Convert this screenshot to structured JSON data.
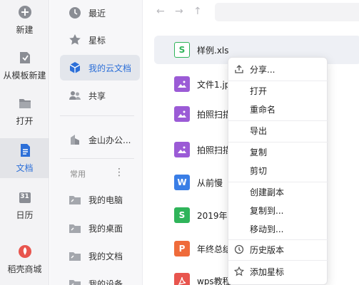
{
  "rail": {
    "items": [
      {
        "label": "新建",
        "icon": "plus-circle-icon"
      },
      {
        "label": "从模板新建",
        "icon": "template-icon"
      },
      {
        "label": "打开",
        "icon": "folder-open-icon"
      },
      {
        "label": "文档",
        "icon": "document-icon"
      },
      {
        "label": "日历",
        "icon": "calendar-icon"
      },
      {
        "label": "稻壳商城",
        "icon": "docer-store-icon"
      }
    ],
    "calendar_day": "31",
    "active_index": 3
  },
  "nav": {
    "items": [
      {
        "label": "最近",
        "icon": "clock-icon"
      },
      {
        "label": "星标",
        "icon": "star-icon"
      },
      {
        "label": "我的云文档",
        "icon": "cloud-cube-icon"
      },
      {
        "label": "共享",
        "icon": "people-icon"
      },
      {
        "label": "金山办公...",
        "icon": "building-icon"
      }
    ],
    "section_label": "常用",
    "section_more": "⋮",
    "shortcuts": [
      {
        "label": "我的电脑",
        "icon": "computer-folder-icon"
      },
      {
        "label": "我的桌面",
        "icon": "desktop-folder-icon"
      },
      {
        "label": "我的文档",
        "icon": "documents-folder-icon"
      },
      {
        "label": "我的设备",
        "icon": "device-folder-icon"
      }
    ],
    "active_index": 2
  },
  "toolbar": {
    "back": "←",
    "forward": "→",
    "up": "↑"
  },
  "files": [
    {
      "name": "样例.xls",
      "type": "sheet",
      "glyph": "S"
    },
    {
      "name": "文件1.jpg",
      "type": "image",
      "glyph": ""
    },
    {
      "name": "拍照扫描",
      "type": "image",
      "glyph": ""
    },
    {
      "name": "拍照扫描",
      "type": "image",
      "glyph": ""
    },
    {
      "name": "从前慢",
      "type": "word",
      "glyph": "W"
    },
    {
      "name": "2019年度",
      "type": "sheet",
      "glyph": "S"
    },
    {
      "name": "年终总结",
      "type": "ppt",
      "glyph": "P"
    },
    {
      "name": "wps教程",
      "type": "pdf",
      "glyph": ""
    }
  ],
  "colors": {
    "accent": "#2c6fd8",
    "sheet": "#2fb45a",
    "image": "#9b5bd6",
    "word": "#3a7ee6",
    "ppt": "#ef6b3a",
    "pdf": "#e8554e"
  },
  "context_menu": {
    "share": "分享...",
    "open": "打开",
    "rename": "重命名",
    "export": "导出",
    "copy": "复制",
    "cut": "剪切",
    "duplicate": "创建副本",
    "copy_to": "复制到...",
    "move_to": "移动到...",
    "history": "历史版本",
    "star": "添加星标"
  }
}
